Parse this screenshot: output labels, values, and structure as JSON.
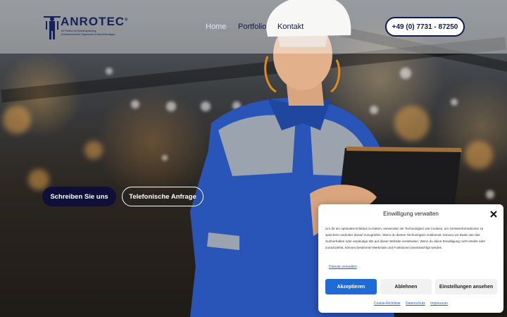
{
  "brand": {
    "name": "ANROTEC",
    "trademark": "®",
    "tagline": "Ihr Partner für Betriebsplanung,\nArbeitssicherheit, Ergonomie & Maschinenlagen"
  },
  "nav": {
    "items": [
      {
        "label": "Home"
      },
      {
        "label": "Portfolio"
      },
      {
        "label": "Kontakt"
      }
    ],
    "phone": "+49 (0) 7731 - 87250"
  },
  "hero": {
    "cta_primary": "Schreiben Sie uns",
    "cta_secondary": "Telefonische Anfrage"
  },
  "consent": {
    "title": "Einwilligung verwalten",
    "body": "Um dir ein optimales Erlebnis zu bieten, verwenden wir Technologien wie Cookies, um Geräteinformationen zu speichern und/oder darauf zuzugreifen. Wenn du diesen Technologien zustimmst, können wir Daten wie das Surfverhalten oder eindeutige IDs auf dieser Website verarbeiten. Wenn du deine Einwilligung nicht erteilst oder zurückziehst, können bestimmte Merkmale und Funktionen beeinträchtigt werden.",
    "link": "Dienste verwalten",
    "accept": "Akzeptieren",
    "reject": "Ablehnen",
    "settings": "Einstellungen ansehen",
    "footer": [
      "Cookie-Richtlinie",
      "Datenschutz",
      "Impressum"
    ]
  },
  "colors": {
    "brand_navy": "#16205c",
    "primary_blue": "#1e6bd6"
  },
  "icons": [
    "worker-logo-icon",
    "close-icon"
  ]
}
